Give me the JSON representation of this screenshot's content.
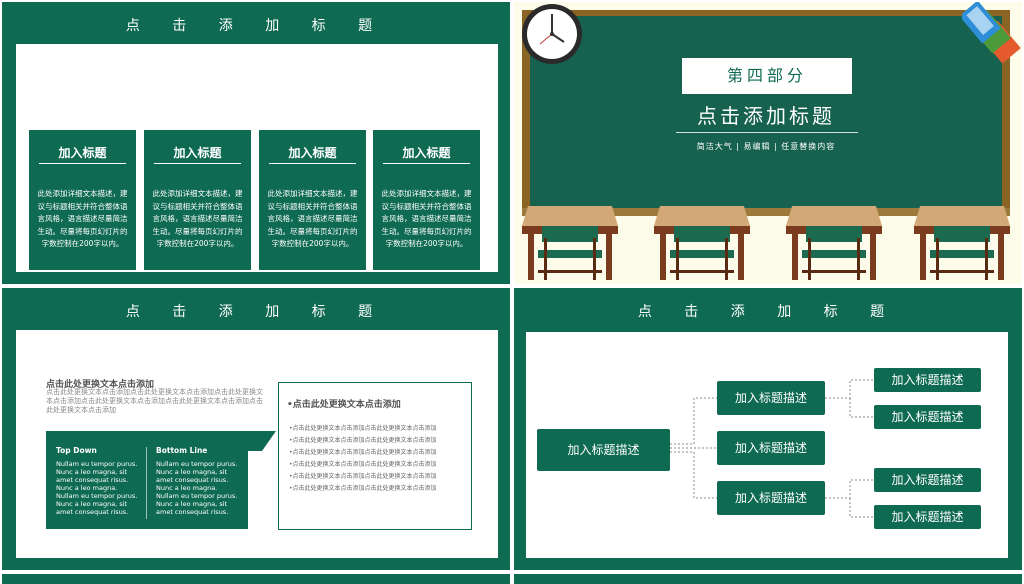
{
  "slide1": {
    "title": "点 击 添 加 标 题",
    "cards": [
      {
        "title": "加入标题",
        "body": "此处添加详细文本描述，建议与标题相关并符合整体语言风格，语言描述尽量简洁生动。尽量将每页幻灯片的字数控制在200字以内。"
      },
      {
        "title": "加入标题",
        "body": "此处添加详细文本描述，建议与标题相关并符合整体语言风格，语言描述尽量简洁生动。尽量将每页幻灯片的字数控制在200字以内。"
      },
      {
        "title": "加入标题",
        "body": "此处添加详细文本描述，建议与标题相关并符合整体语言风格，语言描述尽量简洁生动。尽量将每页幻灯片的字数控制在200字以内。"
      },
      {
        "title": "加入标题",
        "body": "此处添加详细文本描述，建议与标题相关并符合整体语言风格，语言描述尽量简洁生动。尽量将每页幻灯片的字数控制在200字以内。"
      }
    ]
  },
  "slide2": {
    "label": "第四部分",
    "title": "点击添加标题",
    "subtitle": "简洁大气 | 易编辑 | 任意替换内容"
  },
  "slide3": {
    "title": "点 击 添 加 标 题",
    "heading": "点击此处更换文本点击添加",
    "body": "点击此处更换文本点击添加点击此处更换文本点击添加点击此处更换文本点击添加点击此处更换文本点击添加点击此处更换文本点击添加点击此处更换文本点击添加",
    "col1": {
      "heading": "Top Down",
      "text": "Nullam eu tempor purus. Nunc a leo magna, sit amet consequat risus. Nunc a leo magna. Nullam eu tempor purus. Nunc a leo magna, sit amet consequat risus."
    },
    "col2": {
      "heading": "Bottom Line",
      "text": "Nullam eu tempor purus. Nunc a leo magna, sit amet consequat risus. Nunc a leo magna. Nullam eu tempor purus. Nunc a leo magna, sit amet consequat risus."
    },
    "box_heading": "•点击此处更换文本点击添加",
    "box_lines": [
      "•点击此处更换文本点击添加点击此处更换文本点击添加",
      "•点击此处更换文本点击添加点击此处更换文本点击添加",
      "•点击此处更换文本点击添加点击此处更换文本点击添加",
      "•点击此处更换文本点击添加点击此处更换文本点击添加",
      "•点击此处更换文本点击添加点击此处更换文本点击添加",
      "•点击此处更换文本点击添加点击此处更换文本点击添加"
    ]
  },
  "slide4": {
    "title": "点 击 添 加 标 题",
    "root": "加入标题描述",
    "mid": [
      "加入标题描述",
      "加入标题描述",
      "加入标题描述"
    ],
    "leaves": [
      "加入标题描述",
      "加入标题描述",
      "加入标题描述",
      "加入标题描述"
    ]
  },
  "colors": {
    "brand_green": "#0f6a52",
    "desk_top": "#d2a877",
    "desk_body": "#7a3b1e",
    "chair": "#1c6b50"
  }
}
